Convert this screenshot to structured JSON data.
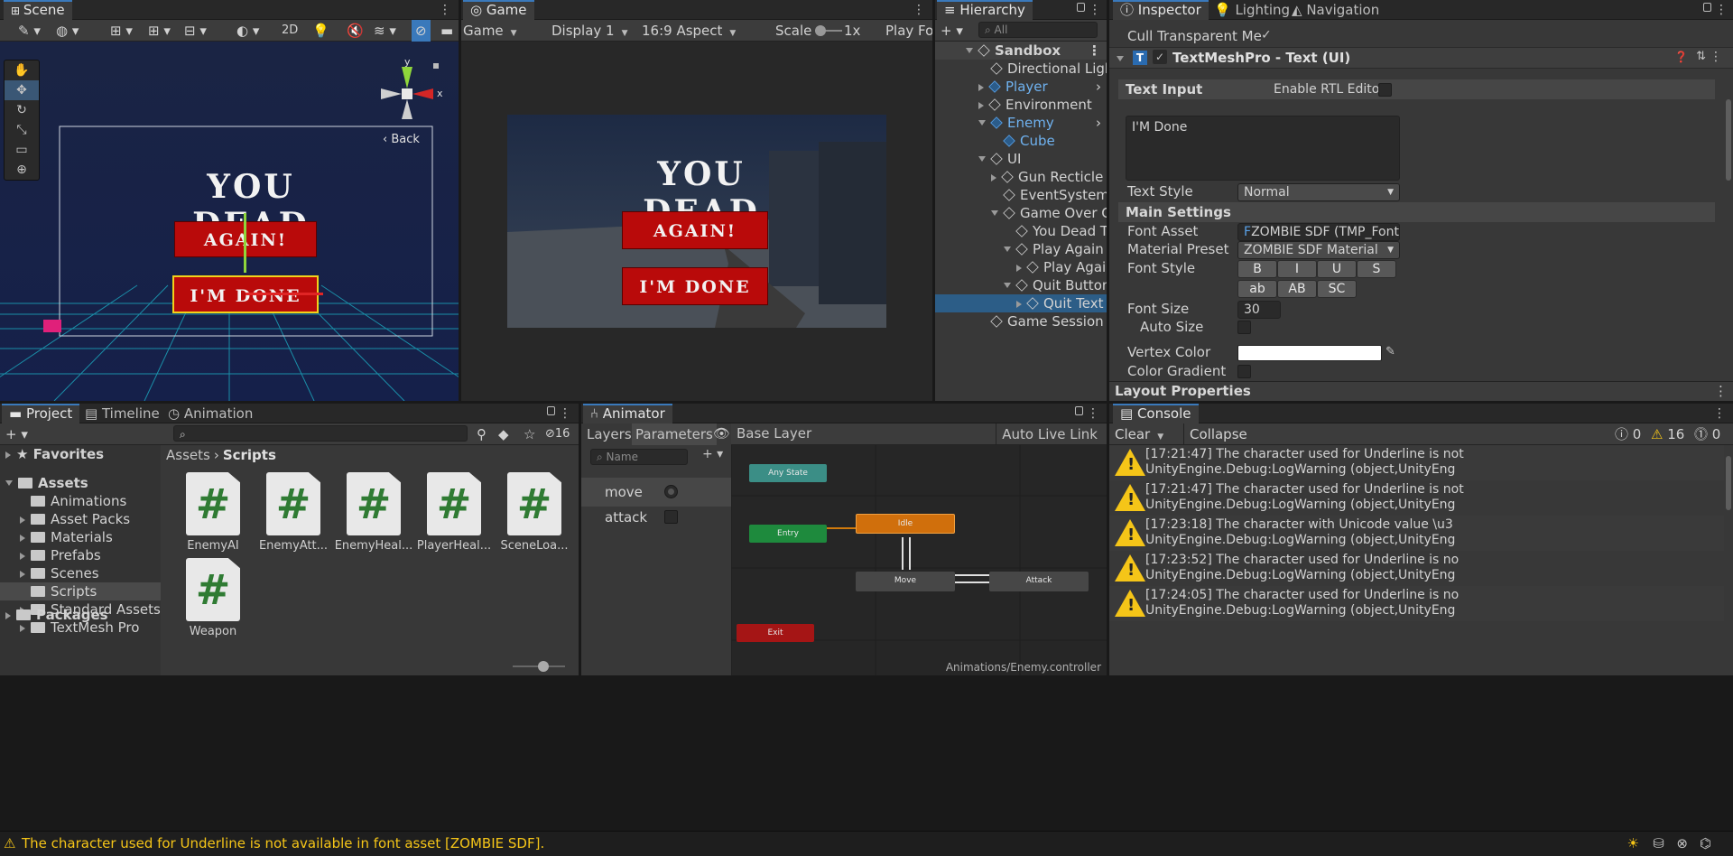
{
  "scene": {
    "tab": "Scene",
    "back_label": "Back",
    "title": "YOU DEAD",
    "again": "AGAIN!",
    "done": "I'M DONE",
    "toolbar_2d": "2D",
    "gizmo_x": "x",
    "gizmo_y": "y"
  },
  "game": {
    "tab": "Game",
    "mode": "Game",
    "display": "Display 1",
    "aspect": "16:9 Aspect",
    "scale_label": "Scale",
    "scale_value": "1x",
    "play_focused": "Play Foc",
    "title": "YOU DEAD",
    "again": "AGAIN!",
    "done": "I'M DONE"
  },
  "hierarchy": {
    "tab": "Hierarchy",
    "search_placeholder": "All",
    "items": [
      {
        "label": "Sandbox",
        "depth": 0,
        "expand": "down",
        "icon": "unity-scene",
        "bold": true
      },
      {
        "label": "Directional Light",
        "depth": 1,
        "expand": "",
        "icon": "gameobject"
      },
      {
        "label": "Player",
        "depth": 1,
        "expand": "right",
        "icon": "prefab",
        "prefab": true
      },
      {
        "label": "Environment",
        "depth": 1,
        "expand": "right",
        "icon": "gameobject"
      },
      {
        "label": "Enemy",
        "depth": 1,
        "expand": "down",
        "icon": "prefab",
        "prefab": true
      },
      {
        "label": "Cube",
        "depth": 2,
        "expand": "",
        "icon": "prefab",
        "prefab": true
      },
      {
        "label": "UI",
        "depth": 1,
        "expand": "down",
        "icon": "gameobject"
      },
      {
        "label": "Gun Recticle Canv",
        "depth": 2,
        "expand": "right",
        "icon": "gameobject"
      },
      {
        "label": "EventSystem",
        "depth": 2,
        "expand": "",
        "icon": "gameobject"
      },
      {
        "label": "Game Over Canva",
        "depth": 2,
        "expand": "down",
        "icon": "gameobject"
      },
      {
        "label": "You Dead Text",
        "depth": 3,
        "expand": "",
        "icon": "gameobject"
      },
      {
        "label": "Play Again Butto",
        "depth": 3,
        "expand": "down",
        "icon": "gameobject"
      },
      {
        "label": "Play Again T",
        "depth": 4,
        "expand": "right",
        "icon": "gameobject"
      },
      {
        "label": "Quit Button",
        "depth": 3,
        "expand": "down",
        "icon": "gameobject"
      },
      {
        "label": "Quit Text",
        "depth": 4,
        "expand": "right",
        "icon": "gameobject",
        "selected": true
      },
      {
        "label": "Game Session",
        "depth": 1,
        "expand": "",
        "icon": "gameobject"
      }
    ]
  },
  "inspector": {
    "tabs": [
      "Inspector",
      "Lighting",
      "Navigation"
    ],
    "cull_label": "Cull Transparent Me",
    "component": "TextMeshPro - Text (UI)",
    "text_input": "Text Input",
    "rtl_label": "Enable RTL Editor",
    "text_value": "I'M Done",
    "text_style_label": "Text Style",
    "text_style_value": "Normal",
    "main_settings": "Main Settings",
    "font_asset_label": "Font Asset",
    "font_asset_value": "ZOMBIE SDF (TMP_Font",
    "material_label": "Material Preset",
    "material_value": "ZOMBIE SDF Material",
    "font_style_label": "Font Style",
    "font_style_buttons": [
      "B",
      "I",
      "U",
      "S",
      "ab",
      "AB",
      "SC"
    ],
    "font_size_label": "Font Size",
    "font_size_value": "30",
    "auto_size_label": "Auto Size",
    "vertex_color_label": "Vertex Color",
    "color_gradient_label": "Color Gradient",
    "layout_properties": "Layout Properties"
  },
  "project": {
    "tabs": [
      "Project",
      "Timeline",
      "Animation"
    ],
    "hidden_count": "16",
    "favorites": "Favorites",
    "assets": "Assets",
    "tree": [
      "Animations",
      "Asset Packs",
      "Materials",
      "Prefabs",
      "Scenes",
      "Scripts",
      "Standard Assets",
      "TextMesh Pro"
    ],
    "packages": "Packages",
    "breadcrumb": [
      "Assets",
      "Scripts"
    ],
    "files": [
      "EnemyAI",
      "EnemyAtt...",
      "EnemyHeal...",
      "PlayerHeal...",
      "SceneLoa...",
      "Weapon"
    ]
  },
  "animator": {
    "tab": "Animator",
    "layers_tab": "Layers",
    "params_tab": "Parameters",
    "base_layer": "Base Layer",
    "auto_live": "Auto Live Link",
    "name_placeholder": "Name",
    "params": [
      {
        "name": "move",
        "type": "bool-dot"
      },
      {
        "name": "attack",
        "type": "bool"
      }
    ],
    "states": {
      "any": "Any State",
      "entry": "Entry",
      "idle": "Idle",
      "move": "Move",
      "attack": "Attack",
      "exit": "Exit"
    },
    "path": "Animations/Enemy.controller"
  },
  "console": {
    "tab": "Console",
    "clear": "Clear",
    "collapse": "Collapse",
    "info_count": "0",
    "warn_count": "16",
    "error_count": "0",
    "entries": [
      {
        "line1": "[17:21:47] The character used for Underline is not",
        "line2": "UnityEngine.Debug:LogWarning (object,UnityEng"
      },
      {
        "line1": "[17:21:47] The character used for Underline is not",
        "line2": "UnityEngine.Debug:LogWarning (object,UnityEng"
      },
      {
        "line1": "[17:23:18] The character with Unicode value \\u3",
        "line2": "UnityEngine.Debug:LogWarning (object,UnityEng"
      },
      {
        "line1": "[17:23:52] The character used for Underline is no",
        "line2": "UnityEngine.Debug:LogWarning (object,UnityEng"
      },
      {
        "line1": "[17:24:05] The character used for Underline is no",
        "line2": "UnityEngine.Debug:LogWarning (object,UnityEng"
      }
    ]
  },
  "status": {
    "message": "The character used for Underline is not available in font asset [ZOMBIE SDF]."
  },
  "colors": {
    "accent": "#3a79bb",
    "selection": "#2c5d87",
    "warning": "#f5c518",
    "button_red": "#b90a0a",
    "idle_state": "#d06f0c",
    "entry_state": "#1e8a3d",
    "exit_state": "#a51515",
    "any_state": "#3b8e86"
  }
}
